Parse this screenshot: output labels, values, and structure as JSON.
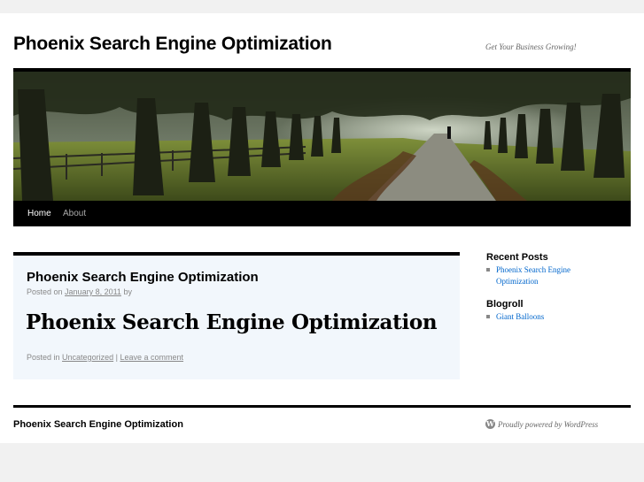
{
  "site": {
    "title": "Phoenix Search Engine Optimization",
    "description": "Get Your Business Growing!"
  },
  "nav": {
    "items": [
      {
        "label": "Home",
        "current": true
      },
      {
        "label": "About",
        "current": false
      }
    ]
  },
  "post": {
    "title": "Phoenix Search Engine Optimization",
    "posted_on": "Posted on",
    "date": "January 8, 2011",
    "by": "by",
    "body_heading": "Phoenix Search Engine Optimization",
    "posted_in": "Posted in",
    "category": "Uncategorized",
    "separator": "|",
    "comment_link": "Leave a comment"
  },
  "sidebar": {
    "recent_posts_title": "Recent Posts",
    "recent_posts": [
      "Phoenix Search Engine Optimization"
    ],
    "blogroll_title": "Blogroll",
    "blogroll": [
      "Giant Balloons"
    ]
  },
  "footer": {
    "site_title": "Phoenix Search Engine Optimization",
    "powered_by": "Proudly powered by WordPress"
  },
  "colors": {
    "link": "#0066cc",
    "post_background": "#f2f7fc",
    "nav_background": "#000000"
  }
}
